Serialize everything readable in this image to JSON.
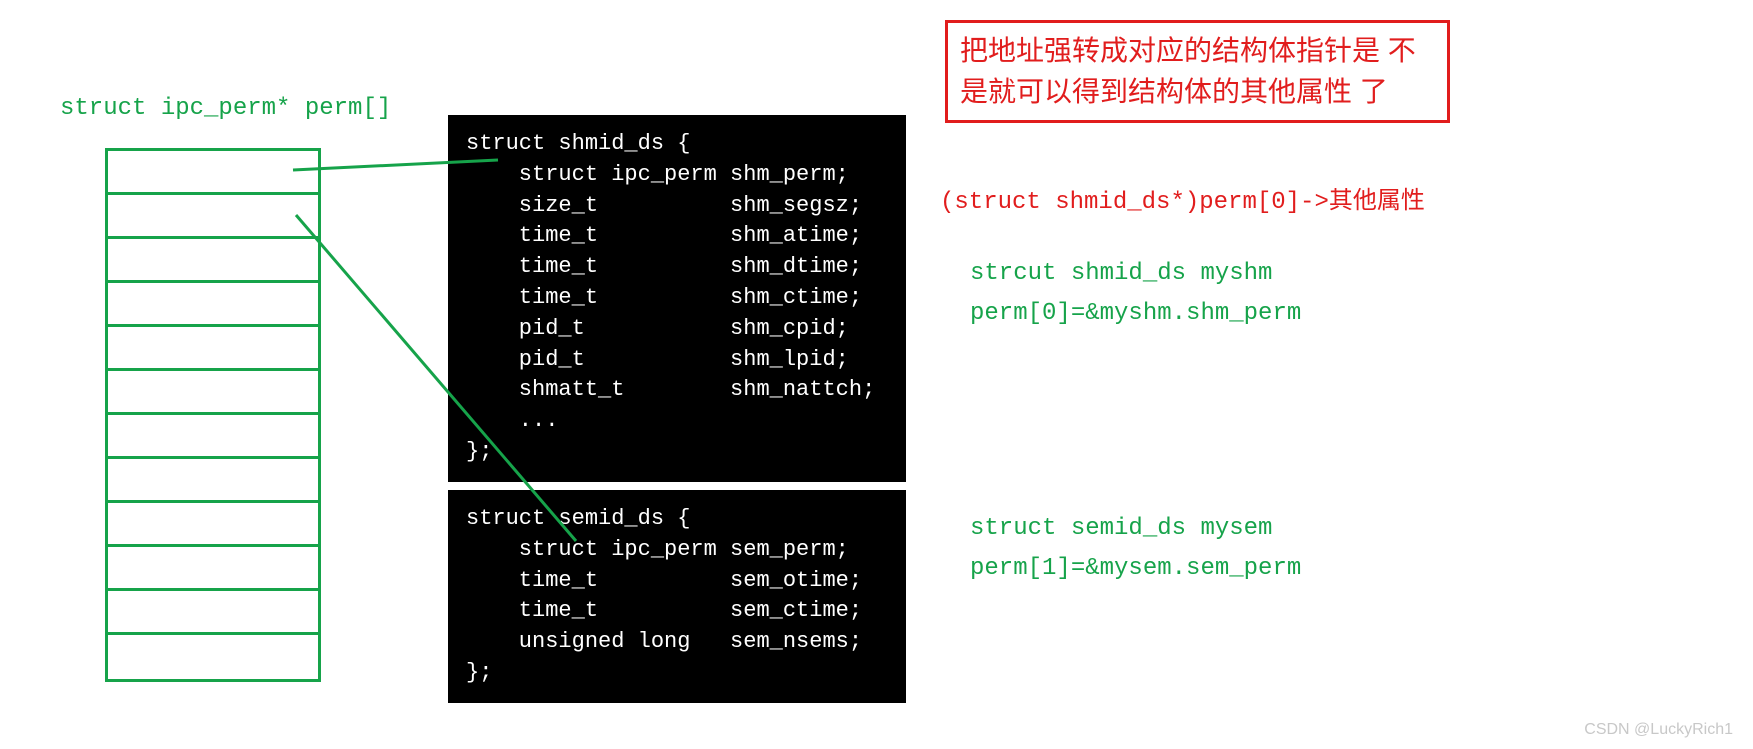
{
  "title": "struct ipc_perm* perm[]",
  "arraySlots": 12,
  "codeBlock1": "struct shmid_ds {\n    struct ipc_perm shm_perm;\n    size_t          shm_segsz;\n    time_t          shm_atime;\n    time_t          shm_dtime;\n    time_t          shm_ctime;\n    pid_t           shm_cpid;\n    pid_t           shm_lpid;\n    shmatt_t        shm_nattch;\n    ...\n};",
  "codeBlock2": "struct semid_ds {\n    struct ipc_perm sem_perm;\n    time_t          sem_otime;\n    time_t          sem_ctime;\n    unsigned long   sem_nsems;\n};",
  "redBoxText": "把地址强转成对应的结构体指针是\n不是就可以得到结构体的其他属性\n了",
  "castExpr": "(struct shmid_ds*)perm[0]->其他属性",
  "greenNote1Line1": "strcut shmid_ds myshm",
  "greenNote1Line2": "perm[0]=&myshm.shm_perm",
  "greenNote2Line1": "struct semid_ds mysem",
  "greenNote2Line2": "perm[1]=&mysem.sem_perm",
  "watermark": "CSDN @LuckyRich1"
}
